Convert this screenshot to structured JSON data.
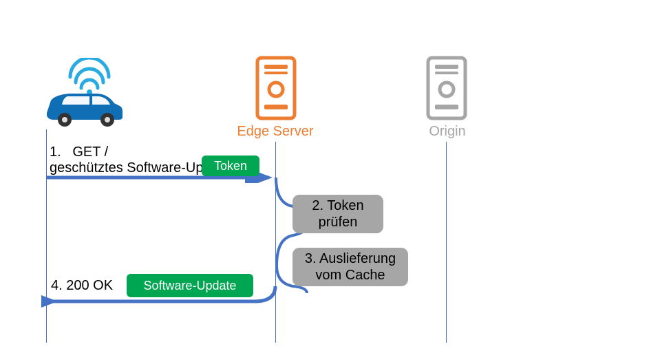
{
  "actors": {
    "edge_label": "Edge Server",
    "origin_label": "Origin"
  },
  "step1": {
    "num_label": "1.",
    "method": "GET /",
    "desc": "geschütztes Software-Update",
    "token_badge": "Token"
  },
  "step2": {
    "text": "2. Token\nprüfen"
  },
  "step3": {
    "text": "3. Auslieferung\nvom Cache"
  },
  "step4": {
    "status": "4. 200 OK",
    "payload_badge": "Software-Update"
  },
  "colors": {
    "edge": "#ed7d31",
    "origin": "#a6a6a6",
    "arrow": "#4472c4",
    "green": "#00a651",
    "car_blue": "#0f6eb4"
  }
}
